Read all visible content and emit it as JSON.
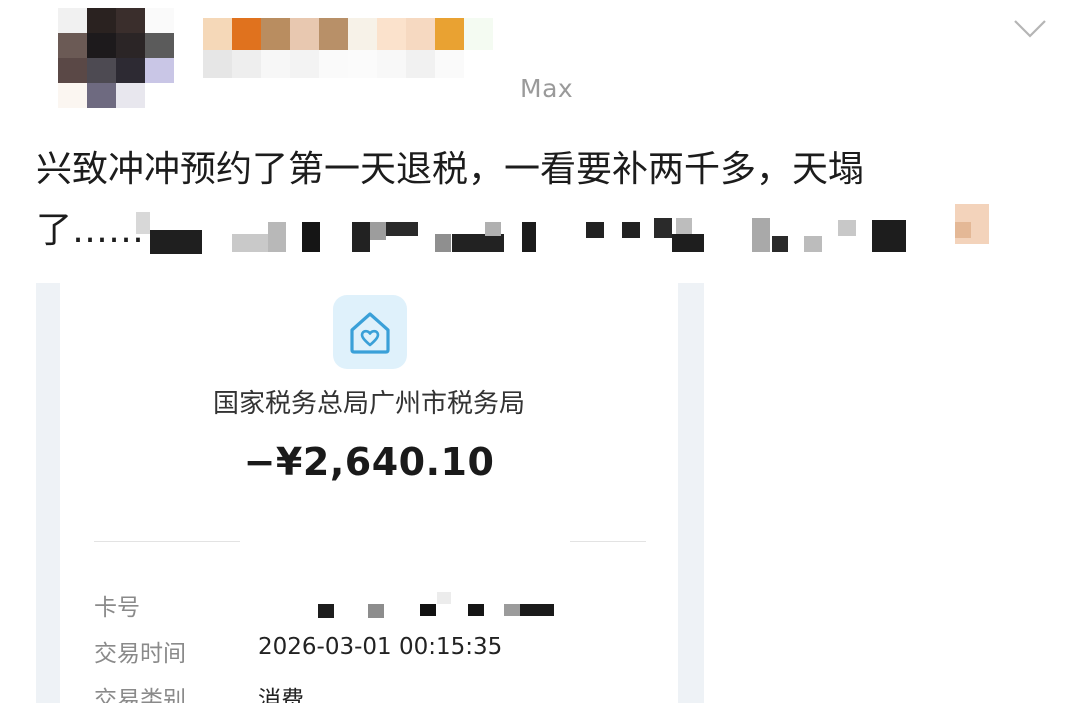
{
  "post": {
    "author_device": "Max",
    "text_line1": "兴致冲冲预约了第一天退税，一看要补两千多，天塌",
    "text_line2_visible": "了……",
    "collapse_icon": "chevron-down-icon"
  },
  "receipt": {
    "icon": "house-heart-icon",
    "merchant": "国家税务总局广州市税务局",
    "amount": "−¥2,640.10",
    "details": [
      {
        "label": "卡号",
        "value": ""
      },
      {
        "label": "交易时间",
        "value": "2026-03-01 00:15:35"
      },
      {
        "label": "交易类别",
        "value": "消费"
      }
    ]
  },
  "colors": {
    "icon_accent": "#3aa0d8",
    "icon_bg": "#dff1fb"
  }
}
